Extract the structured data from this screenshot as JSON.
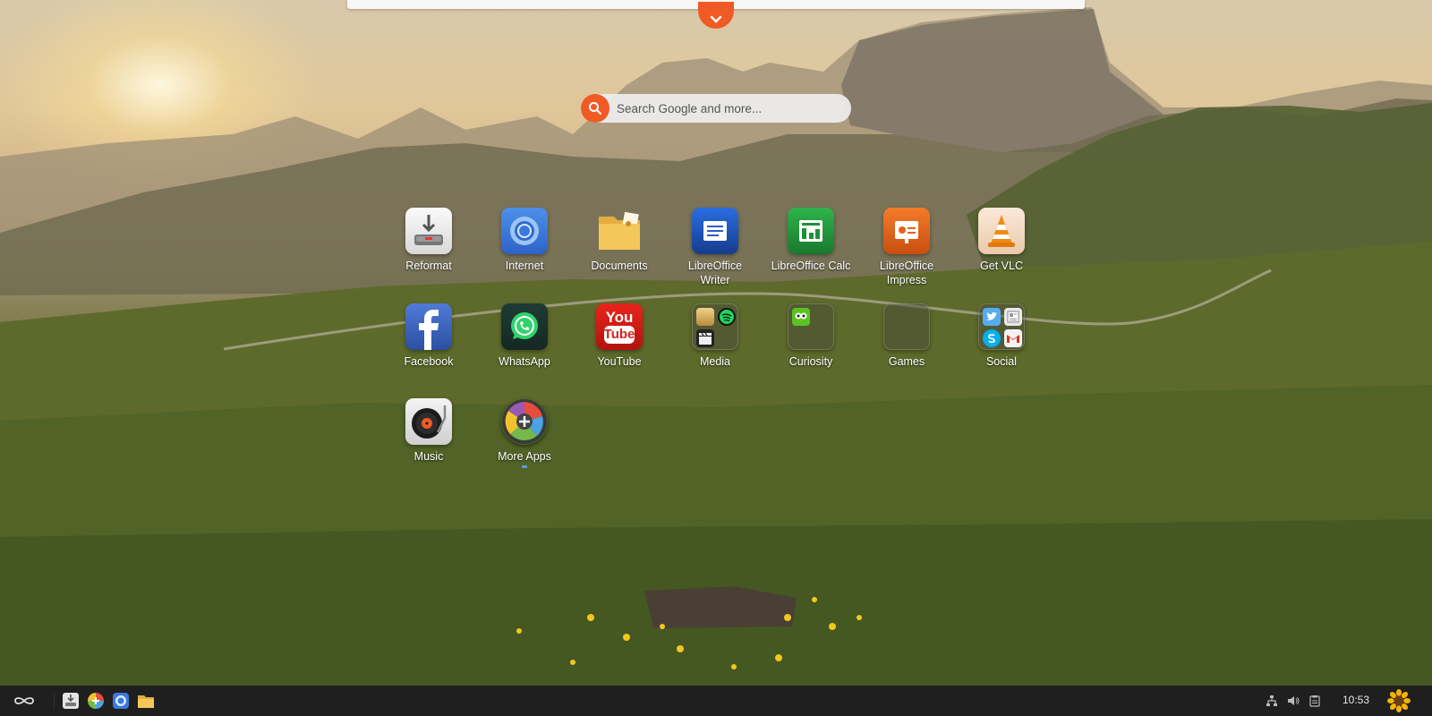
{
  "search": {
    "placeholder": "Search Google and more..."
  },
  "apps": [
    {
      "label": "Reformat",
      "icon": "reformat-icon"
    },
    {
      "label": "Internet",
      "icon": "chromium-icon"
    },
    {
      "label": "Documents",
      "icon": "documents-folder-icon"
    },
    {
      "label": "LibreOffice Writer",
      "icon": "libreoffice-writer-icon"
    },
    {
      "label": "LibreOffice Calc",
      "icon": "libreoffice-calc-icon"
    },
    {
      "label": "LibreOffice Impress",
      "icon": "libreoffice-impress-icon"
    },
    {
      "label": "Get VLC",
      "icon": "vlc-icon"
    },
    {
      "label": "Facebook",
      "icon": "facebook-icon"
    },
    {
      "label": "WhatsApp",
      "icon": "whatsapp-icon"
    },
    {
      "label": "YouTube",
      "icon": "youtube-icon"
    },
    {
      "label": "Media",
      "icon": "media-folder-icon"
    },
    {
      "label": "Curiosity",
      "icon": "curiosity-folder-icon"
    },
    {
      "label": "Games",
      "icon": "games-folder-icon"
    },
    {
      "label": "Social",
      "icon": "social-folder-icon"
    },
    {
      "label": "Music",
      "icon": "music-icon"
    },
    {
      "label": "More Apps",
      "icon": "more-apps-icon"
    }
  ],
  "youtube_text": {
    "top": "You",
    "bottom": "Tube"
  },
  "taskbar": {
    "clock": "10:53",
    "pinned": [
      "reformat-icon",
      "app-center-icon",
      "chromium-icon",
      "files-icon"
    ],
    "tray": [
      "network-icon",
      "volume-icon",
      "clipboard-icon"
    ]
  },
  "colors": {
    "accent": "#f05a24",
    "taskbar": "#1f1f1f"
  }
}
